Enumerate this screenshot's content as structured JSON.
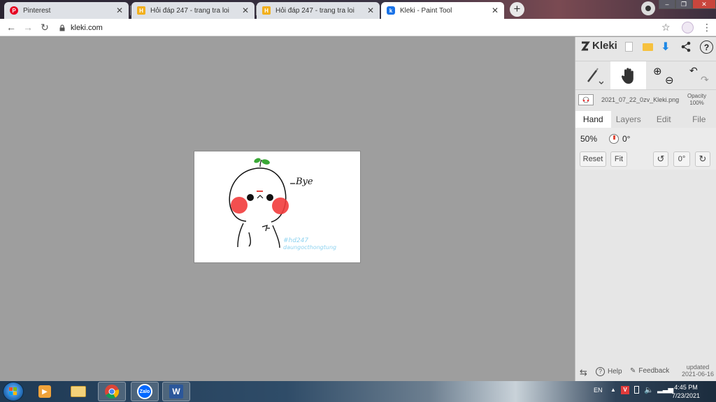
{
  "browser": {
    "tabs": [
      {
        "title": "Pinterest",
        "favicon": "pinterest-icon",
        "color": "#e60023",
        "active": false
      },
      {
        "title": "Hỏi đáp 247 - trang tra loi",
        "favicon": "hoidap-icon",
        "color": "#f2b01e",
        "active": false
      },
      {
        "title": "Hỏi đáp 247 - trang tra loi",
        "favicon": "hoidap-icon",
        "color": "#f2b01e",
        "active": false
      },
      {
        "title": "Kleki - Paint Tool",
        "favicon": "kleki-icon",
        "color": "#1a73e8",
        "active": true
      }
    ],
    "url": "kleki.com"
  },
  "drawing": {
    "caption": "Bye",
    "watermark_line1": "#hd247",
    "watermark_line2": "daungocthongtung"
  },
  "kleki": {
    "logo": "Kleki",
    "filename": "2021_07_22_0zv_Kleki.png",
    "opacity_label": "Opacity",
    "opacity_value": "100%",
    "tabs": [
      "Hand",
      "Layers",
      "Edit",
      "File"
    ],
    "active_tab": "Hand",
    "zoom": "50%",
    "angle": "0°",
    "reset_label": "Reset",
    "fit_label": "Fit",
    "rotate_value": "0°",
    "help_label": "Help",
    "feedback_label": "Feedback",
    "updated_label": "updated",
    "updated_date": "2021-06-16"
  },
  "taskbar": {
    "language": "EN",
    "time": "4:45 PM",
    "date": "7/23/2021"
  }
}
